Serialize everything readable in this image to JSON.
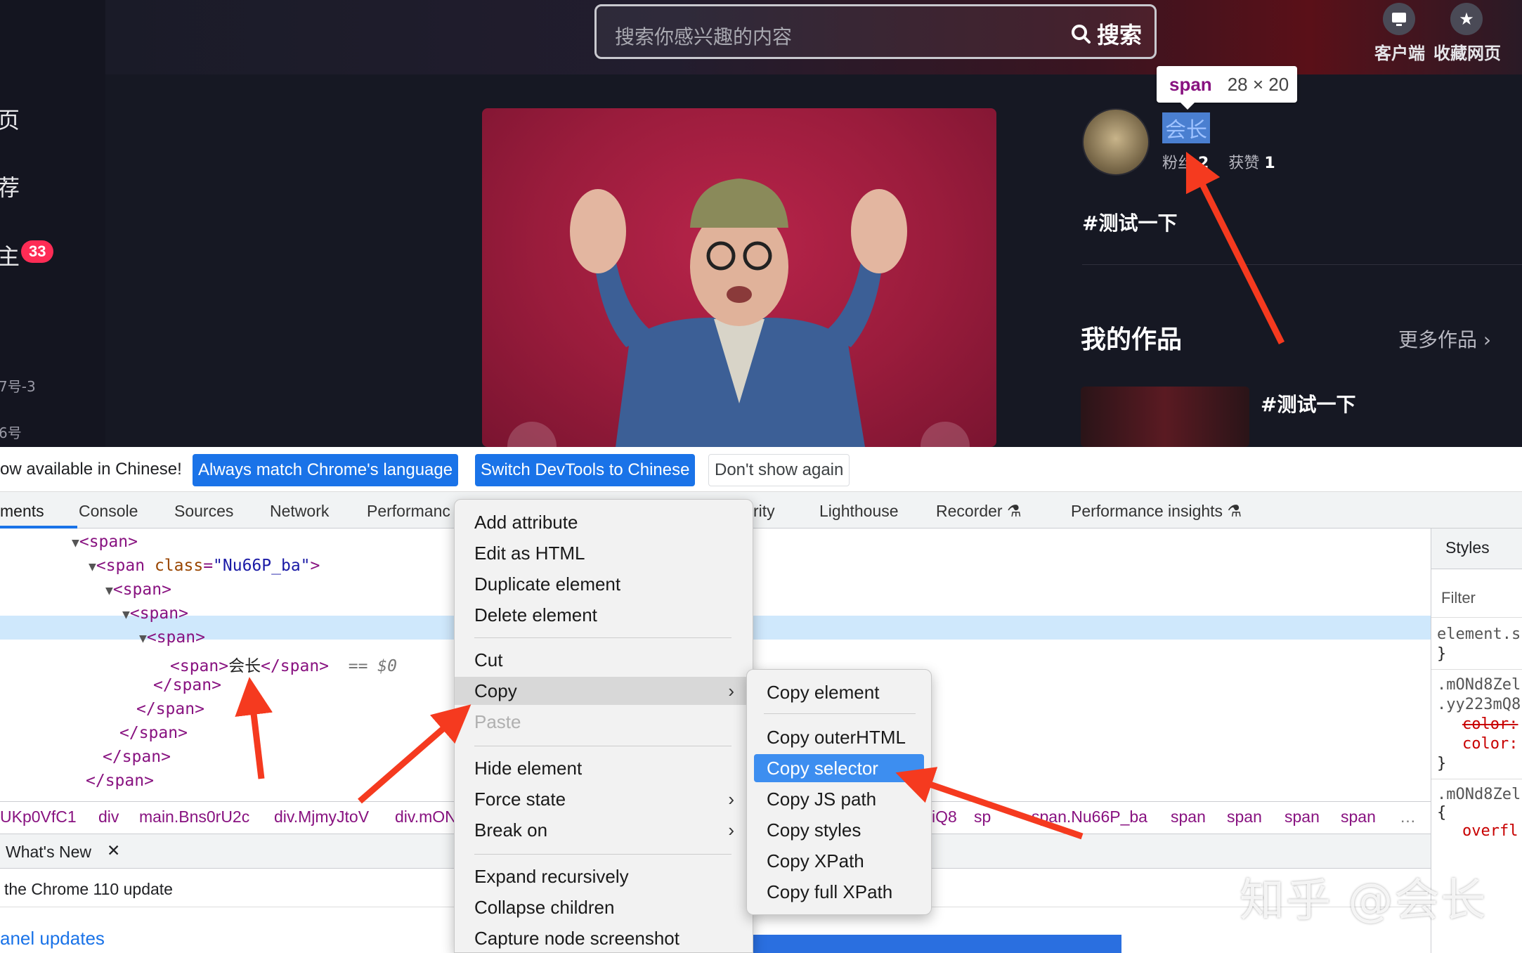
{
  "web": {
    "nav": {
      "item1": "页",
      "item2": "荐",
      "item3": "主",
      "badge": "33",
      "footer1": "7号-3",
      "footer2": "6号"
    },
    "search": {
      "placeholder": "搜索你感兴趣的内容",
      "button": "搜索"
    },
    "top_actions": [
      {
        "label": "客户端",
        "icon": "monitor-icon"
      },
      {
        "label": "收藏网页",
        "icon": "star-icon"
      }
    ],
    "tooltip": {
      "tag": "span",
      "dims": "28 × 20"
    },
    "user": {
      "name": "会长",
      "fans_label": "粉丝",
      "fans": "2",
      "likes_label": "获赞",
      "likes": "1"
    },
    "hashtag": "#测试一下",
    "my_works": "我的作品",
    "more_works": "更多作品",
    "work_title": "#测试一下"
  },
  "devtools": {
    "infobar": {
      "text": "ow available in Chinese!",
      "btn_match": "Always match Chrome's language",
      "btn_switch": "Switch DevTools to Chinese",
      "btn_dismiss": "Don't show again"
    },
    "tabs": [
      "ments",
      "Console",
      "Sources",
      "Network",
      "Performanc",
      "rity",
      "Lighthouse",
      "Recorder",
      "Performance insights"
    ],
    "dom": {
      "l1": "<span>",
      "l2_tag": "<span ",
      "l2_attr": "class",
      "l2_val": "\"Nu66P_ba\"",
      "l2_end": ">",
      "l3": "<span>",
      "l4": "<span>",
      "l5": "<span>",
      "sel_open": "<span>",
      "sel_text": "会长",
      "sel_close": "</span>",
      "sel_eq": "== $0",
      "c1": "</span>",
      "c2": "</span>",
      "c3": "</span>",
      "c4": "</span>",
      "c5": "</span>"
    },
    "breadcrumbs": [
      "UKp0VfC1",
      "div",
      "main.Bns0rU2c",
      "div.MjmyJtoV",
      "div.mON",
      "iQ8",
      "sp",
      "span.Nu66P_ba",
      "span",
      "span",
      "span",
      "span",
      "…"
    ],
    "drawer": {
      "tab": "What's New",
      "line1": "the Chrome 110 update",
      "line2": "anel updates"
    },
    "styles": {
      "tab": "Styles",
      "filter": "Filter",
      "r1": "element.s",
      "r1_close": "}",
      "r2a": ".mONd8Zel",
      "r2b": ".yy223mQ8",
      "r2_p1": "color:",
      "r2_p2": "color:",
      "r2_close": "}",
      "r3a": ".mONd8Zel",
      "r3_open": "{",
      "r3_p1": "overfl"
    }
  },
  "context_menu": {
    "items": [
      "Add attribute",
      "Edit as HTML",
      "Duplicate element",
      "Delete element",
      "Cut",
      "Copy",
      "Paste",
      "Hide element",
      "Force state",
      "Break on",
      "Expand recursively",
      "Collapse children",
      "Capture node screenshot"
    ]
  },
  "copy_submenu": {
    "items": [
      "Copy element",
      "Copy outerHTML",
      "Copy selector",
      "Copy JS path",
      "Copy styles",
      "Copy XPath",
      "Copy full XPath"
    ]
  },
  "watermark": "知乎 @会长",
  "colors": {
    "arrow": "#f53a1f",
    "highlight": "#3d8ef0",
    "primary_button": "#1a73e8",
    "badge": "#fe2c55"
  }
}
